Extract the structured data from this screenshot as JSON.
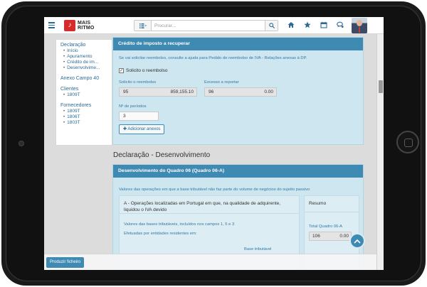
{
  "app": {
    "logo_line1": "MAIS",
    "logo_line2": "RITMO"
  },
  "search": {
    "placeholder": "Procurar..."
  },
  "topbar_icons": [
    "home-icon",
    "star-icon",
    "calendar-icon",
    "chat-icon"
  ],
  "nav": {
    "declaracao": {
      "header": "Declaração",
      "items": [
        "Início",
        "Apuramento",
        "Crédito de im...",
        "Desenvolvime..."
      ]
    },
    "anexo": "Anexo Campo 40",
    "clientes": {
      "header": "Clientes",
      "items": [
        "1809T"
      ]
    },
    "fornecedores": {
      "header": "Fornecedores",
      "items": [
        "1809T",
        "1806T",
        "1803T"
      ]
    }
  },
  "credit_panel": {
    "title": "Crédito de imposto a recuperar",
    "note": "Se vai solicitar reembolso, consulte a ajuda para Pedido de reembolso de IVA - Relações anexas à DP.",
    "checkbox_label": "Solicito o reembolso",
    "checkbox_checked": true,
    "solicito_label": "Solicito o reembolso",
    "solicito_code": "95",
    "solicito_value": "859,155.10",
    "excesso_label": "Excesso a reportar",
    "excesso_code": "96",
    "excesso_value": "0.00",
    "periodos_label": "Nº de períodos",
    "periodos_value": "3",
    "add_attachments": "Adicionar anexos"
  },
  "section_title": "Declaração - Desenvolvimento",
  "quadro_panel": {
    "title": "Desenvolvimento do Quadro 06 (Quadro 06-A)",
    "note": "Valores das operações em que a base tributável não faz parte do volume de negócios do sujeito passivo",
    "op_a": "A - Operações localizadas em Portugal em que, na qualidade de adquirente, liquidou o IVA devido",
    "bases_note": "Valores das bases tributáveis, incluídos nos campos 1, 5 e 3",
    "efetuadas": "Efetuadas por entidades residentes em:",
    "base_tributavel": "Base tributável",
    "resumo": "Resumo",
    "total_label": "Total Quadro 06-A",
    "total_code": "106",
    "total_value": "0.00"
  },
  "footer": {
    "produce_button": "Produzir ficheiro"
  },
  "colors": {
    "accent": "#3f8ab3",
    "panel_bg": "#cde6f0",
    "brand_red": "#d52b2b"
  }
}
